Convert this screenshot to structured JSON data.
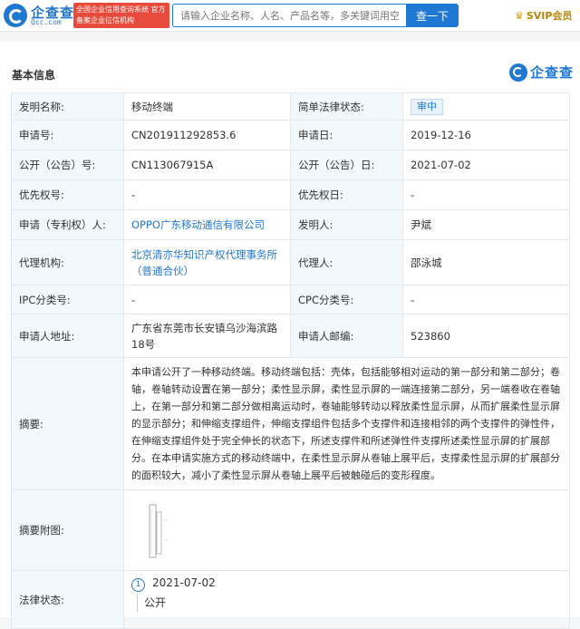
{
  "header": {
    "brand": "企查查",
    "brand_sub": "Qcc.com",
    "tag_text": "全国企业信用查询系统 官方备案企业征信机构",
    "search_placeholder": "请输入企业名称、人名、产品名等，多关键词用空",
    "search_button": "查一下",
    "vip_label": "SVIP会员"
  },
  "section": {
    "title": "基本信息",
    "brand": "企查查"
  },
  "info": {
    "invention_name_label": "发明名称:",
    "invention_name": "移动终端",
    "legal_status_label": "简单法律状态:",
    "legal_status": "审中",
    "app_no_label": "申请号:",
    "app_no": "CN201911292853.6",
    "app_date_label": "申请日:",
    "app_date": "2019-12-16",
    "pub_no_label": "公开（公告）号:",
    "pub_no": "CN113067915A",
    "pub_date_label": "公开（公告）日:",
    "pub_date": "2021-07-02",
    "priority_no_label": "优先权号:",
    "priority_no": "-",
    "priority_date_label": "优先权日:",
    "priority_date": "-",
    "applicant_label": "申请（专利权）人:",
    "applicant": "OPPO广东移动通信有限公司",
    "inventor_label": "发明人:",
    "inventor": "尹斌",
    "agency_label": "代理机构:",
    "agency": "北京清亦华知识产权代理事务所（普通合伙）",
    "agent_label": "代理人:",
    "agent": "邵泳城",
    "ipc_label": "IPC分类号:",
    "ipc": "-",
    "cpc_label": "CPC分类号:",
    "cpc": "-",
    "address_label": "申请人地址:",
    "address": "广东省东莞市长安镇乌沙海滨路18号",
    "postcode_label": "申请人邮编:",
    "postcode": "523860",
    "abstract_label": "摘要:",
    "abstract": "本申请公开了一种移动终端。移动终端包括：壳体，包括能够相对运动的第一部分和第二部分；卷轴，卷轴转动设置在第一部分；柔性显示屏，柔性显示屏的一端连接第二部分，另一端卷收在卷轴上，在第一部分和第二部分做相离运动时，卷轴能够转动以释放柔性显示屏，从而扩展柔性显示屏的显示部分；和伸缩支撑组件，伸缩支撑组件包括多个支撑件和连接相邻的两个支撑件的弹性件，在伸缩支撑组件处于完全伸长的状态下，所述支撑件和所述弹性件支撑所述柔性显示屏的扩展部分。在本申请实施方式的移动终端中，在柔性显示屏从卷轴上展平后，支撑柔性显示屏的扩展部分的面积较大，减小了柔性显示屏从卷轴上展平后被触碰后的变形程度。",
    "figure_label": "摘要附图:",
    "legal_label": "法律状态:",
    "legal_index": "1",
    "legal_date": "2021-07-02",
    "legal_event": "公开"
  }
}
